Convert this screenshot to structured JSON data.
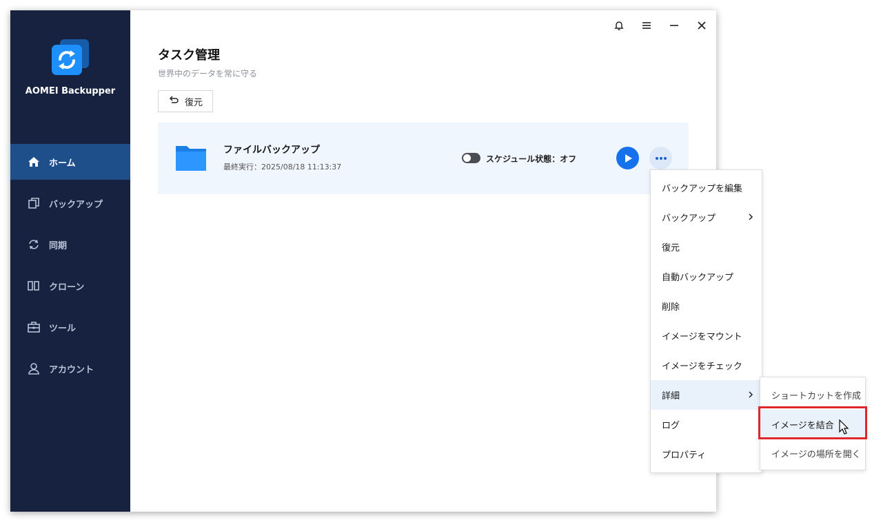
{
  "app": {
    "name": "AOMEI Backupper"
  },
  "sidebar": {
    "items": [
      {
        "label": "ホーム",
        "icon": "home-icon",
        "active": true
      },
      {
        "label": "バックアップ",
        "icon": "backup-icon",
        "active": false
      },
      {
        "label": "同期",
        "icon": "sync-icon",
        "active": false
      },
      {
        "label": "クローン",
        "icon": "clone-icon",
        "active": false
      },
      {
        "label": "ツール",
        "icon": "tools-icon",
        "active": false
      },
      {
        "label": "アカウント",
        "icon": "account-icon",
        "active": false
      }
    ]
  },
  "window_controls": [
    "bell-icon",
    "menu-icon",
    "minimize-icon",
    "close-icon"
  ],
  "main": {
    "title": "タスク管理",
    "subtitle": "世界中のデータを常に守る",
    "restore_button": "復元"
  },
  "task": {
    "name": "ファイルバックアップ",
    "last_run": "最終実行：2025/08/18 11:13:37",
    "schedule_status": "スケジュール状態：オフ",
    "schedule_enabled": false
  },
  "context_menu": {
    "items": [
      {
        "label": "バックアップを編集",
        "has_submenu": false
      },
      {
        "label": "バックアップ",
        "has_submenu": true
      },
      {
        "label": "復元",
        "has_submenu": false
      },
      {
        "label": "自動バックアップ",
        "has_submenu": false
      },
      {
        "label": "削除",
        "has_submenu": false
      },
      {
        "label": "イメージをマウント",
        "has_submenu": false
      },
      {
        "label": "イメージをチェック",
        "has_submenu": false
      },
      {
        "label": "詳細",
        "has_submenu": true,
        "active": true
      },
      {
        "label": "ログ",
        "has_submenu": false
      },
      {
        "label": "プロパティ",
        "has_submenu": false
      }
    ]
  },
  "submenu": {
    "items": [
      {
        "label": "ショートカットを作成"
      },
      {
        "label": "イメージを結合",
        "highlighted": true
      },
      {
        "label": "イメージの場所を開く"
      }
    ]
  },
  "colors": {
    "sidebar_bg": "#16223f",
    "sidebar_active": "#1f4f8a",
    "accent": "#1672ec",
    "card_bg": "#f0f6fd",
    "highlight_red": "#e0262b"
  }
}
